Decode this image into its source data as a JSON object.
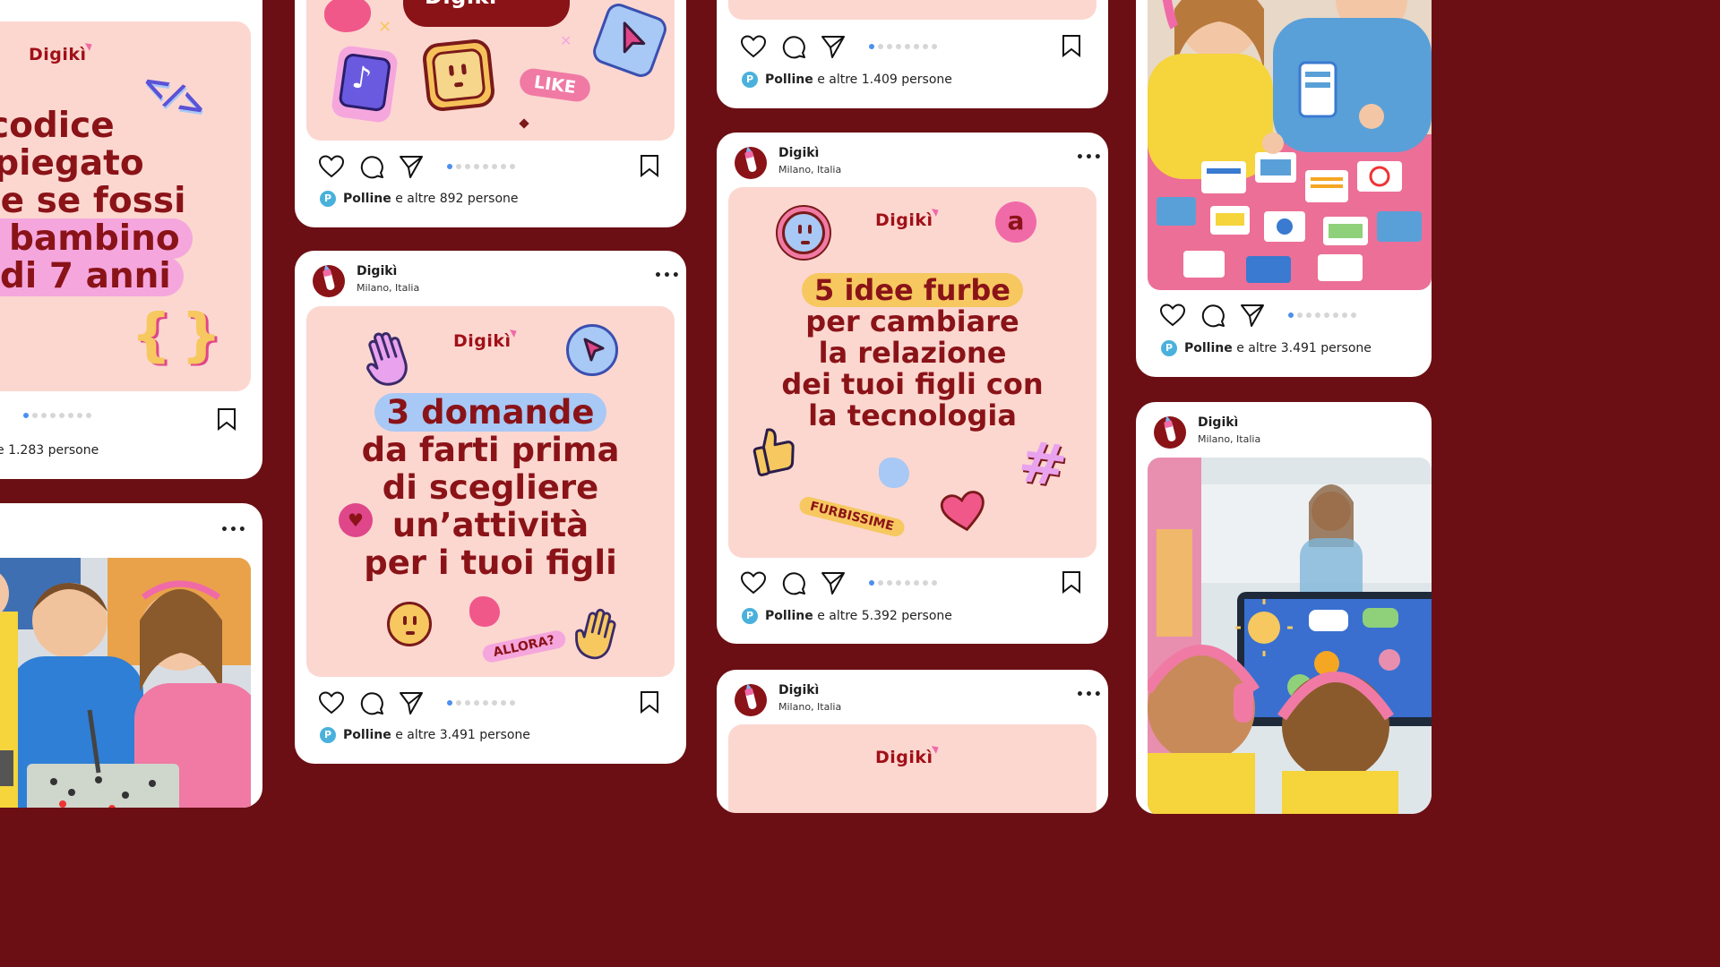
{
  "account": {
    "name": "Digikì",
    "location": "Milano, Italia",
    "more": "•••"
  },
  "like_prefix_name": "Polline",
  "cards": {
    "c1_top": {
      "headline_lines": [
        "l codice",
        "spiegato",
        "me se fossi",
        "bambino",
        "di 7 anni"
      ],
      "logo": "Digikì",
      "code_symbol": "</>",
      "brace_symbol": "{ }",
      "likes": "e 1.283 persone"
    },
    "c1_bottom": {
      "photo": "children building electronic circuit"
    },
    "c2_top": {
      "logo": "Digikì",
      "like_tag": "LIKE",
      "likes": " e altre 892 persone"
    },
    "c2_main": {
      "logo": "Digikì",
      "headline_lines": [
        "3 domande",
        "da farti prima",
        "di scegliere",
        "un’attività",
        "per i tuoi figli"
      ],
      "tag": "ALLORA?",
      "likes": " e altre 3.491 persone"
    },
    "c3_top": {
      "likes": " e altre 1.409 persone"
    },
    "c3_main": {
      "logo": "Digikì",
      "headline_lines": [
        "5 idee furbe",
        "per cambiare",
        "la relazione",
        "dei tuoi figli con",
        "la tecnologia"
      ],
      "at_symbol": "a",
      "hash_symbol": "#",
      "tag": "FURBISSIME",
      "likes": " e altre 5.392 persone"
    },
    "c3_bottom": {
      "logo": "Digikì"
    },
    "c4_top": {
      "photo": "children playing with app icon cards",
      "likes": " e altre 3.491 persone"
    },
    "c4_bottom": {
      "photo": "children with headphones in classroom"
    }
  },
  "colors": {
    "background": "#6b0f14",
    "post_bg": "#fcd7d0",
    "brand": "#8a1318",
    "pink": "#f06aa8",
    "blue": "#a8c8f5",
    "yellow": "#f6c85f"
  },
  "icons": [
    "heart-icon",
    "comment-icon",
    "send-icon",
    "bookmark-icon",
    "pin-icon"
  ]
}
